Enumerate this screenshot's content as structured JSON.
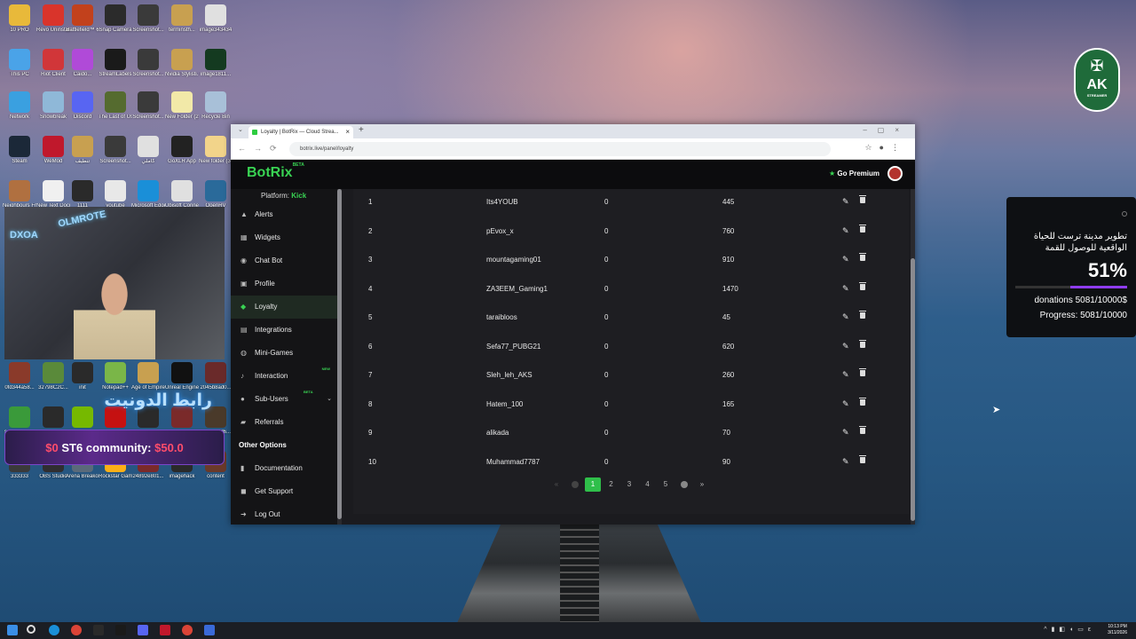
{
  "desktop": {
    "icons": [
      {
        "label": "10 PRO",
        "color": "#e8b93a"
      },
      {
        "label": "Revo Uninstaller",
        "color": "#d9342b"
      },
      {
        "label": "Battlefield™ 6",
        "color": "#c2411c"
      },
      {
        "label": "Snap Camera",
        "color": "#2b2b2b"
      },
      {
        "label": "Screenshot...",
        "color": "#3a3a3a"
      },
      {
        "label": "terminsth...",
        "color": "#c8a050"
      },
      {
        "label": "image343434",
        "color": "#e0e0e0"
      },
      {
        "label": "This PC",
        "color": "#4aa3e8"
      },
      {
        "label": "Riot Client",
        "color": "#d13639"
      },
      {
        "label": "Caido...",
        "color": "#b04ad8"
      },
      {
        "label": "StreamLabels",
        "color": "#1a1a1a"
      },
      {
        "label": "Screenshot...",
        "color": "#3a3a3a"
      },
      {
        "label": "Nvidia Stylisti...",
        "color": "#c8a050"
      },
      {
        "label": "image1811...",
        "color": "#143a20"
      },
      {
        "label": "Network",
        "color": "#3aa0e0"
      },
      {
        "label": "Snowbreak",
        "color": "#8fb8d8"
      },
      {
        "label": "Discord",
        "color": "#5865f2"
      },
      {
        "label": "The Last of Us™ Part I",
        "color": "#556b2f"
      },
      {
        "label": "Screenshot...",
        "color": "#3a3a3a"
      },
      {
        "label": "New Folder (2)",
        "color": "#f2e9a8"
      },
      {
        "label": "Recycle Bin",
        "color": "#a8c0d8"
      },
      {
        "label": "Steam",
        "color": "#1b2838"
      },
      {
        "label": "WeMod",
        "color": "#c0182c"
      },
      {
        "label": "تنظيف",
        "color": "#c8a050"
      },
      {
        "label": "Screenshot...",
        "color": "#3a3a3a"
      },
      {
        "label": "كاملي",
        "color": "#e0e0e0"
      },
      {
        "label": "GoXLR App",
        "color": "#222"
      },
      {
        "label": "New folder (3)",
        "color": "#f2d48a"
      },
      {
        "label": "Neighbours From Hell 2",
        "color": "#b07040"
      },
      {
        "label": "New Text Docume...",
        "color": "#f0f0f0"
      },
      {
        "label": "1111",
        "color": "#2a2a2a"
      },
      {
        "label": "youtube",
        "color": "#e8e8e8"
      },
      {
        "label": "Microsoft Edge",
        "color": "#1a8fd8"
      },
      {
        "label": "Ubisoft Connect",
        "color": "#e0e0e0"
      },
      {
        "label": "OpenRV",
        "color": "#2a6a9a"
      },
      {
        "label": "0fd344a58...",
        "color": "#8a3a2a"
      },
      {
        "label": "32798C2C...",
        "color": "#5a8a3a"
      },
      {
        "label": "init",
        "color": "#2a2a2a"
      },
      {
        "label": "Notepad++",
        "color": "#7ab648"
      },
      {
        "label": "Age of Empires...",
        "color": "#c8a050"
      },
      {
        "label": "Unreal Engine",
        "color": "#111"
      },
      {
        "label": "2045b8ad0...",
        "color": "#6a2a2a"
      },
      {
        "label": "sowbx1tow...",
        "color": "#3a9a3a"
      },
      {
        "label": "...aaa",
        "color": "#2a2a2a"
      },
      {
        "label": "NVIDIA App",
        "color": "#76b900"
      },
      {
        "label": "Among Us",
        "color": "#c51111"
      },
      {
        "label": "re3",
        "color": "#2a2a2a"
      },
      {
        "label": "392abbad8...",
        "color": "#7a2a2a"
      },
      {
        "label": "E19866fd6...",
        "color": "#4a3a2a"
      },
      {
        "label": "333333",
        "color": "#3a3a3a"
      },
      {
        "label": "OBS Studio",
        "color": "#302e31"
      },
      {
        "label": "Arena Breako...",
        "color": "#5a6a7a"
      },
      {
        "label": "Rockstar Games...",
        "color": "#fcaf17"
      },
      {
        "label": "24892e801...",
        "color": "#7a2a2a"
      },
      {
        "label": "imagehack",
        "color": "#2a2a2a"
      },
      {
        "label": "content",
        "color": "#6a3a2a"
      }
    ]
  },
  "webcam": {
    "neon_left": "DXOA",
    "neon_right": "OLMROTE"
  },
  "overlay": {
    "arabic_banner": "رابط الدونيت",
    "community_label": "ST6 community:",
    "community_amount_left": "$0",
    "community_amount_right": "$50.0"
  },
  "logo": {
    "text": "AK",
    "subtext": "STREAMER"
  },
  "donation_widget": {
    "title": "تطوير مدينة ترست للحياة الواقعية للوصول للقمة",
    "percent_label": "51%",
    "progress_fraction": 0.51,
    "donations_line": "donations 5081/10000$",
    "progress_line": "Progress: 5081/10000",
    "fill_color": "#8f3cf0"
  },
  "browser": {
    "tab_title": "Loyalty | BotRix — Cloud Strea...",
    "url": "botrix.live/panel/loyalty"
  },
  "app": {
    "brand": "BotRix",
    "brand_badge": "BETA",
    "premium_label": "Go Premium",
    "accent": "#39d353",
    "platform_label": "Platform:",
    "platform_value": "Kick",
    "nav": [
      {
        "label": "Alerts",
        "icon": "bell-icon",
        "glyph": "▲"
      },
      {
        "label": "Widgets",
        "icon": "grid-icon",
        "glyph": "▦"
      },
      {
        "label": "Chat Bot",
        "icon": "robot-icon",
        "glyph": "◉"
      },
      {
        "label": "Profile",
        "icon": "profile-icon",
        "glyph": "▣"
      },
      {
        "label": "Loyalty",
        "icon": "coins-icon",
        "glyph": "◆"
      },
      {
        "label": "Integrations",
        "icon": "integrations-icon",
        "glyph": "▤"
      },
      {
        "label": "Mini-Games",
        "icon": "gamepad-icon",
        "glyph": "◍"
      },
      {
        "label": "Interaction",
        "icon": "music-icon",
        "glyph": "♪"
      },
      {
        "label": "Sub-Users",
        "icon": "users-icon",
        "glyph": "●"
      },
      {
        "label": "Referrals",
        "icon": "referrals-icon",
        "glyph": "▰"
      }
    ],
    "nav_badges": {
      "interaction": "NEW",
      "subusers": "BETA"
    },
    "other_options_title": "Other Options",
    "other_nav": [
      {
        "label": "Documentation",
        "icon": "book-icon",
        "glyph": "▮"
      },
      {
        "label": "Get Support",
        "icon": "support-icon",
        "glyph": "◼"
      },
      {
        "label": "Log Out",
        "icon": "logout-icon",
        "glyph": "➜"
      }
    ]
  },
  "leaderboard": {
    "rows": [
      {
        "rank": "1",
        "name": "Its4YOUB",
        "x": "0",
        "points": "445"
      },
      {
        "rank": "2",
        "name": "pEvox_x",
        "x": "0",
        "points": "760"
      },
      {
        "rank": "3",
        "name": "mountagaming01",
        "x": "0",
        "points": "910"
      },
      {
        "rank": "4",
        "name": "ZA3EEM_Gaming1",
        "x": "0",
        "points": "1470"
      },
      {
        "rank": "5",
        "name": "taraibloos",
        "x": "0",
        "points": "45"
      },
      {
        "rank": "6",
        "name": "Sefa77_PUBG21",
        "x": "0",
        "points": "620"
      },
      {
        "rank": "7",
        "name": "Sleh_leh_AKS",
        "x": "0",
        "points": "260"
      },
      {
        "rank": "8",
        "name": "Hatem_100",
        "x": "0",
        "points": "165"
      },
      {
        "rank": "9",
        "name": "alikada",
        "x": "0",
        "points": "70"
      },
      {
        "rank": "10",
        "name": "Muhammad7787",
        "x": "0",
        "points": "90"
      }
    ]
  },
  "pagination": {
    "first": "«",
    "pages": [
      "1",
      "2",
      "3",
      "4",
      "5"
    ],
    "current": "1",
    "last": "»"
  },
  "taskbar": {
    "clock_time": "10:13 PM",
    "clock_date": "3/11/2026",
    "tray_lang": "ε"
  }
}
